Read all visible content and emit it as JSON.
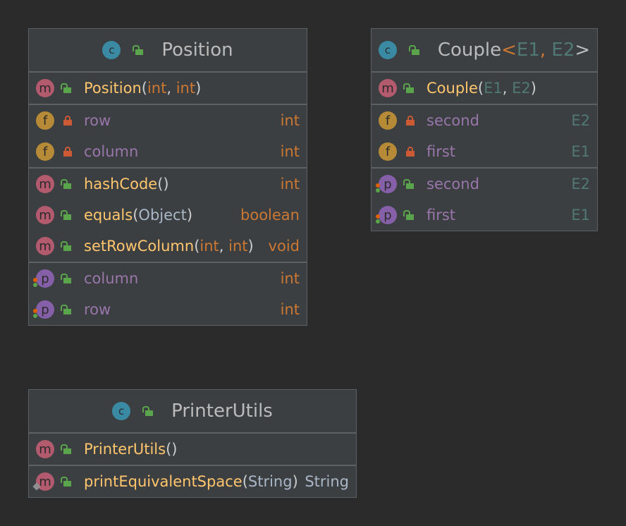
{
  "position_class": {
    "title": "Position",
    "constructor": {
      "name": "Position",
      "param1": "int",
      "param2": "int"
    },
    "fields": [
      {
        "name": "row",
        "type": "int"
      },
      {
        "name": "column",
        "type": "int"
      }
    ],
    "methods": [
      {
        "name": "hashCode",
        "type": "int"
      },
      {
        "name": "equals",
        "param": "Object",
        "type": "boolean"
      },
      {
        "name": "setRowColumn",
        "param1": "int",
        "param2": "int",
        "type": "void"
      }
    ],
    "properties": [
      {
        "name": "column",
        "type": "int"
      },
      {
        "name": "row",
        "type": "int"
      }
    ]
  },
  "couple_class": {
    "title": "Couple",
    "type_param1": "E1",
    "type_param2": "E2",
    "constructor": {
      "name": "Couple",
      "param1": "E1",
      "param2": "E2"
    },
    "fields": [
      {
        "name": "second",
        "type": "E2"
      },
      {
        "name": "first",
        "type": "E1"
      }
    ],
    "properties": [
      {
        "name": "second",
        "type": "E2"
      },
      {
        "name": "first",
        "type": "E1"
      }
    ]
  },
  "printer_class": {
    "title": "PrinterUtils",
    "constructor": {
      "name": "PrinterUtils"
    },
    "methods": [
      {
        "name": "printEquivalentSpace",
        "param": "String",
        "type": "String"
      }
    ]
  },
  "icons": {
    "class_badge": "class-icon",
    "method_badge": "method-icon",
    "field_badge": "field-icon",
    "property_badge": "property-icon",
    "public_visibility": "public-lock-open-icon",
    "private_visibility": "private-lock-closed-icon"
  },
  "colors": {
    "background": "#2b2b2b",
    "card": "#3c3f41",
    "border": "#5e6163",
    "method_name": "#ffc66d",
    "field_name": "#9876aa",
    "keyword_type": "#cc7832",
    "generic_type": "#507874",
    "class_badge": "#3a8aa4",
    "method_badge": "#b35a6e",
    "field_badge": "#b68a36",
    "property_badge": "#8560a8"
  },
  "badge_letters": {
    "class": "c",
    "method": "m",
    "field": "f",
    "property": "p"
  }
}
